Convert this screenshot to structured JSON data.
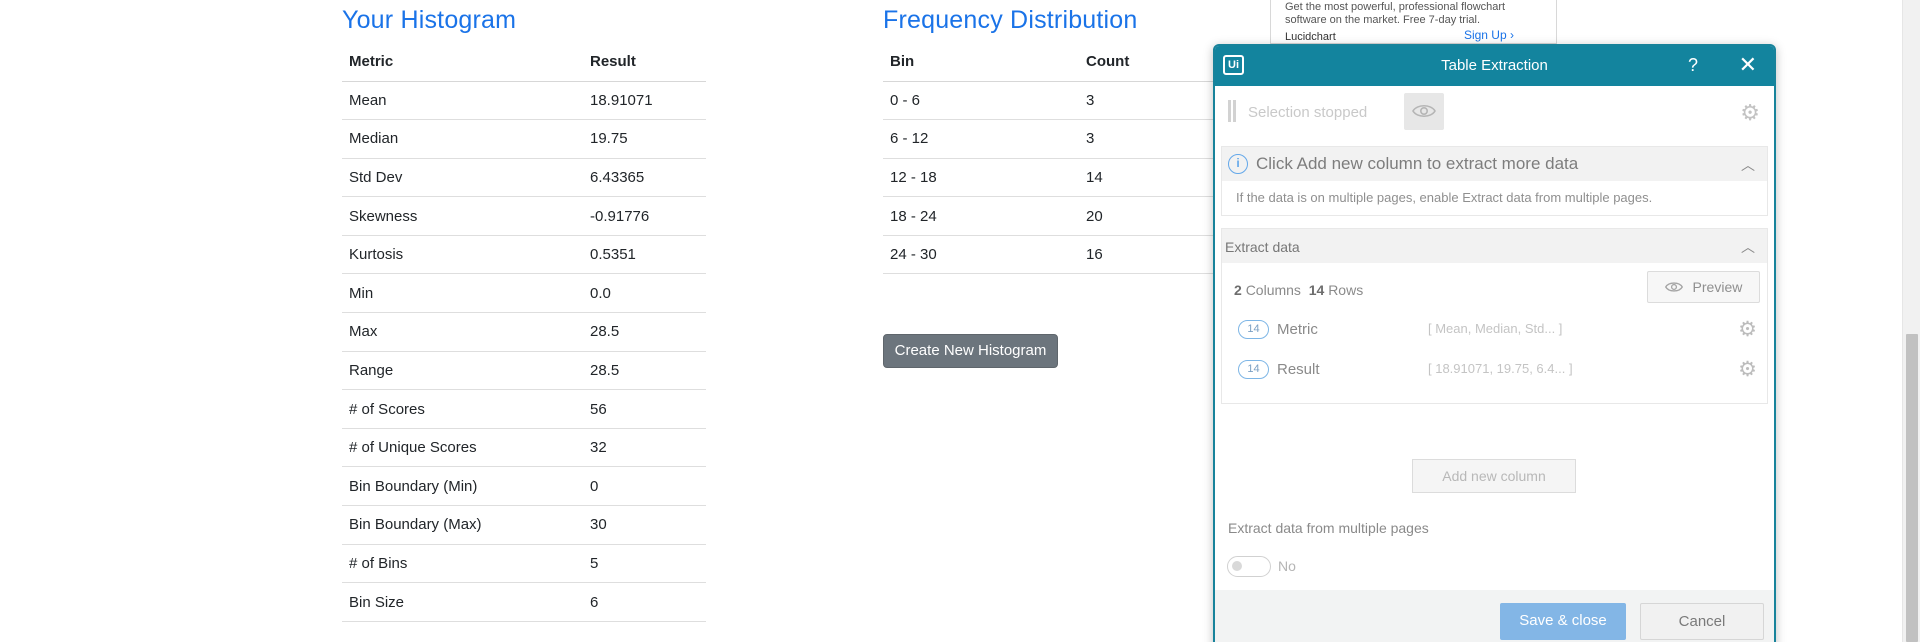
{
  "histogram": {
    "title": "Your Histogram",
    "headers": [
      "Metric",
      "Result"
    ],
    "rows": [
      [
        "Mean",
        "18.91071"
      ],
      [
        "Median",
        "19.75"
      ],
      [
        "Std Dev",
        "6.43365"
      ],
      [
        "Skewness",
        "-0.91776"
      ],
      [
        "Kurtosis",
        "0.5351"
      ],
      [
        "Min",
        "0.0"
      ],
      [
        "Max",
        "28.5"
      ],
      [
        "Range",
        "28.5"
      ],
      [
        "# of Scores",
        "56"
      ],
      [
        "# of Unique Scores",
        "32"
      ],
      [
        "Bin Boundary (Min)",
        "0"
      ],
      [
        "Bin Boundary (Max)",
        "30"
      ],
      [
        "# of Bins",
        "5"
      ],
      [
        "Bin Size",
        "6"
      ]
    ]
  },
  "frequency": {
    "title": "Frequency Distribution",
    "headers": [
      "Bin",
      "Count"
    ],
    "rows": [
      [
        "0 - 6",
        "3"
      ],
      [
        "6 - 12",
        "3"
      ],
      [
        "12 - 18",
        "14"
      ],
      [
        "18 - 24",
        "20"
      ],
      [
        "24 - 30",
        "16"
      ]
    ],
    "create_button": "Create New Histogram"
  },
  "ad": {
    "text": "Get the most powerful, professional flowchart software on the market. Free 7-day trial.",
    "brand": "Lucidchart",
    "cta": "Sign Up"
  },
  "dialog": {
    "logo": "Ui",
    "title": "Table Extraction",
    "help": "?",
    "close": "✕",
    "selection_status": "Selection stopped",
    "info_title": "Click Add new column to extract more data",
    "info_text": "If the data is on multiple pages, enable Extract data from multiple pages.",
    "extract_title": "Extract data",
    "columns_count": "2",
    "columns_label": "Columns",
    "rows_count": "14",
    "rows_label": "Rows",
    "preview_label": "Preview",
    "columns": [
      {
        "count": "14",
        "name": "Metric",
        "preview": "[ Mean, Median, Std... ]"
      },
      {
        "count": "14",
        "name": "Result",
        "preview": "[ 18.91071, 19.75, 6.4... ]"
      }
    ],
    "add_column_label": "Add new column",
    "multi_page_label": "Extract data from multiple pages",
    "multi_page_value": "No",
    "save_label": "Save & close",
    "cancel_label": "Cancel"
  }
}
